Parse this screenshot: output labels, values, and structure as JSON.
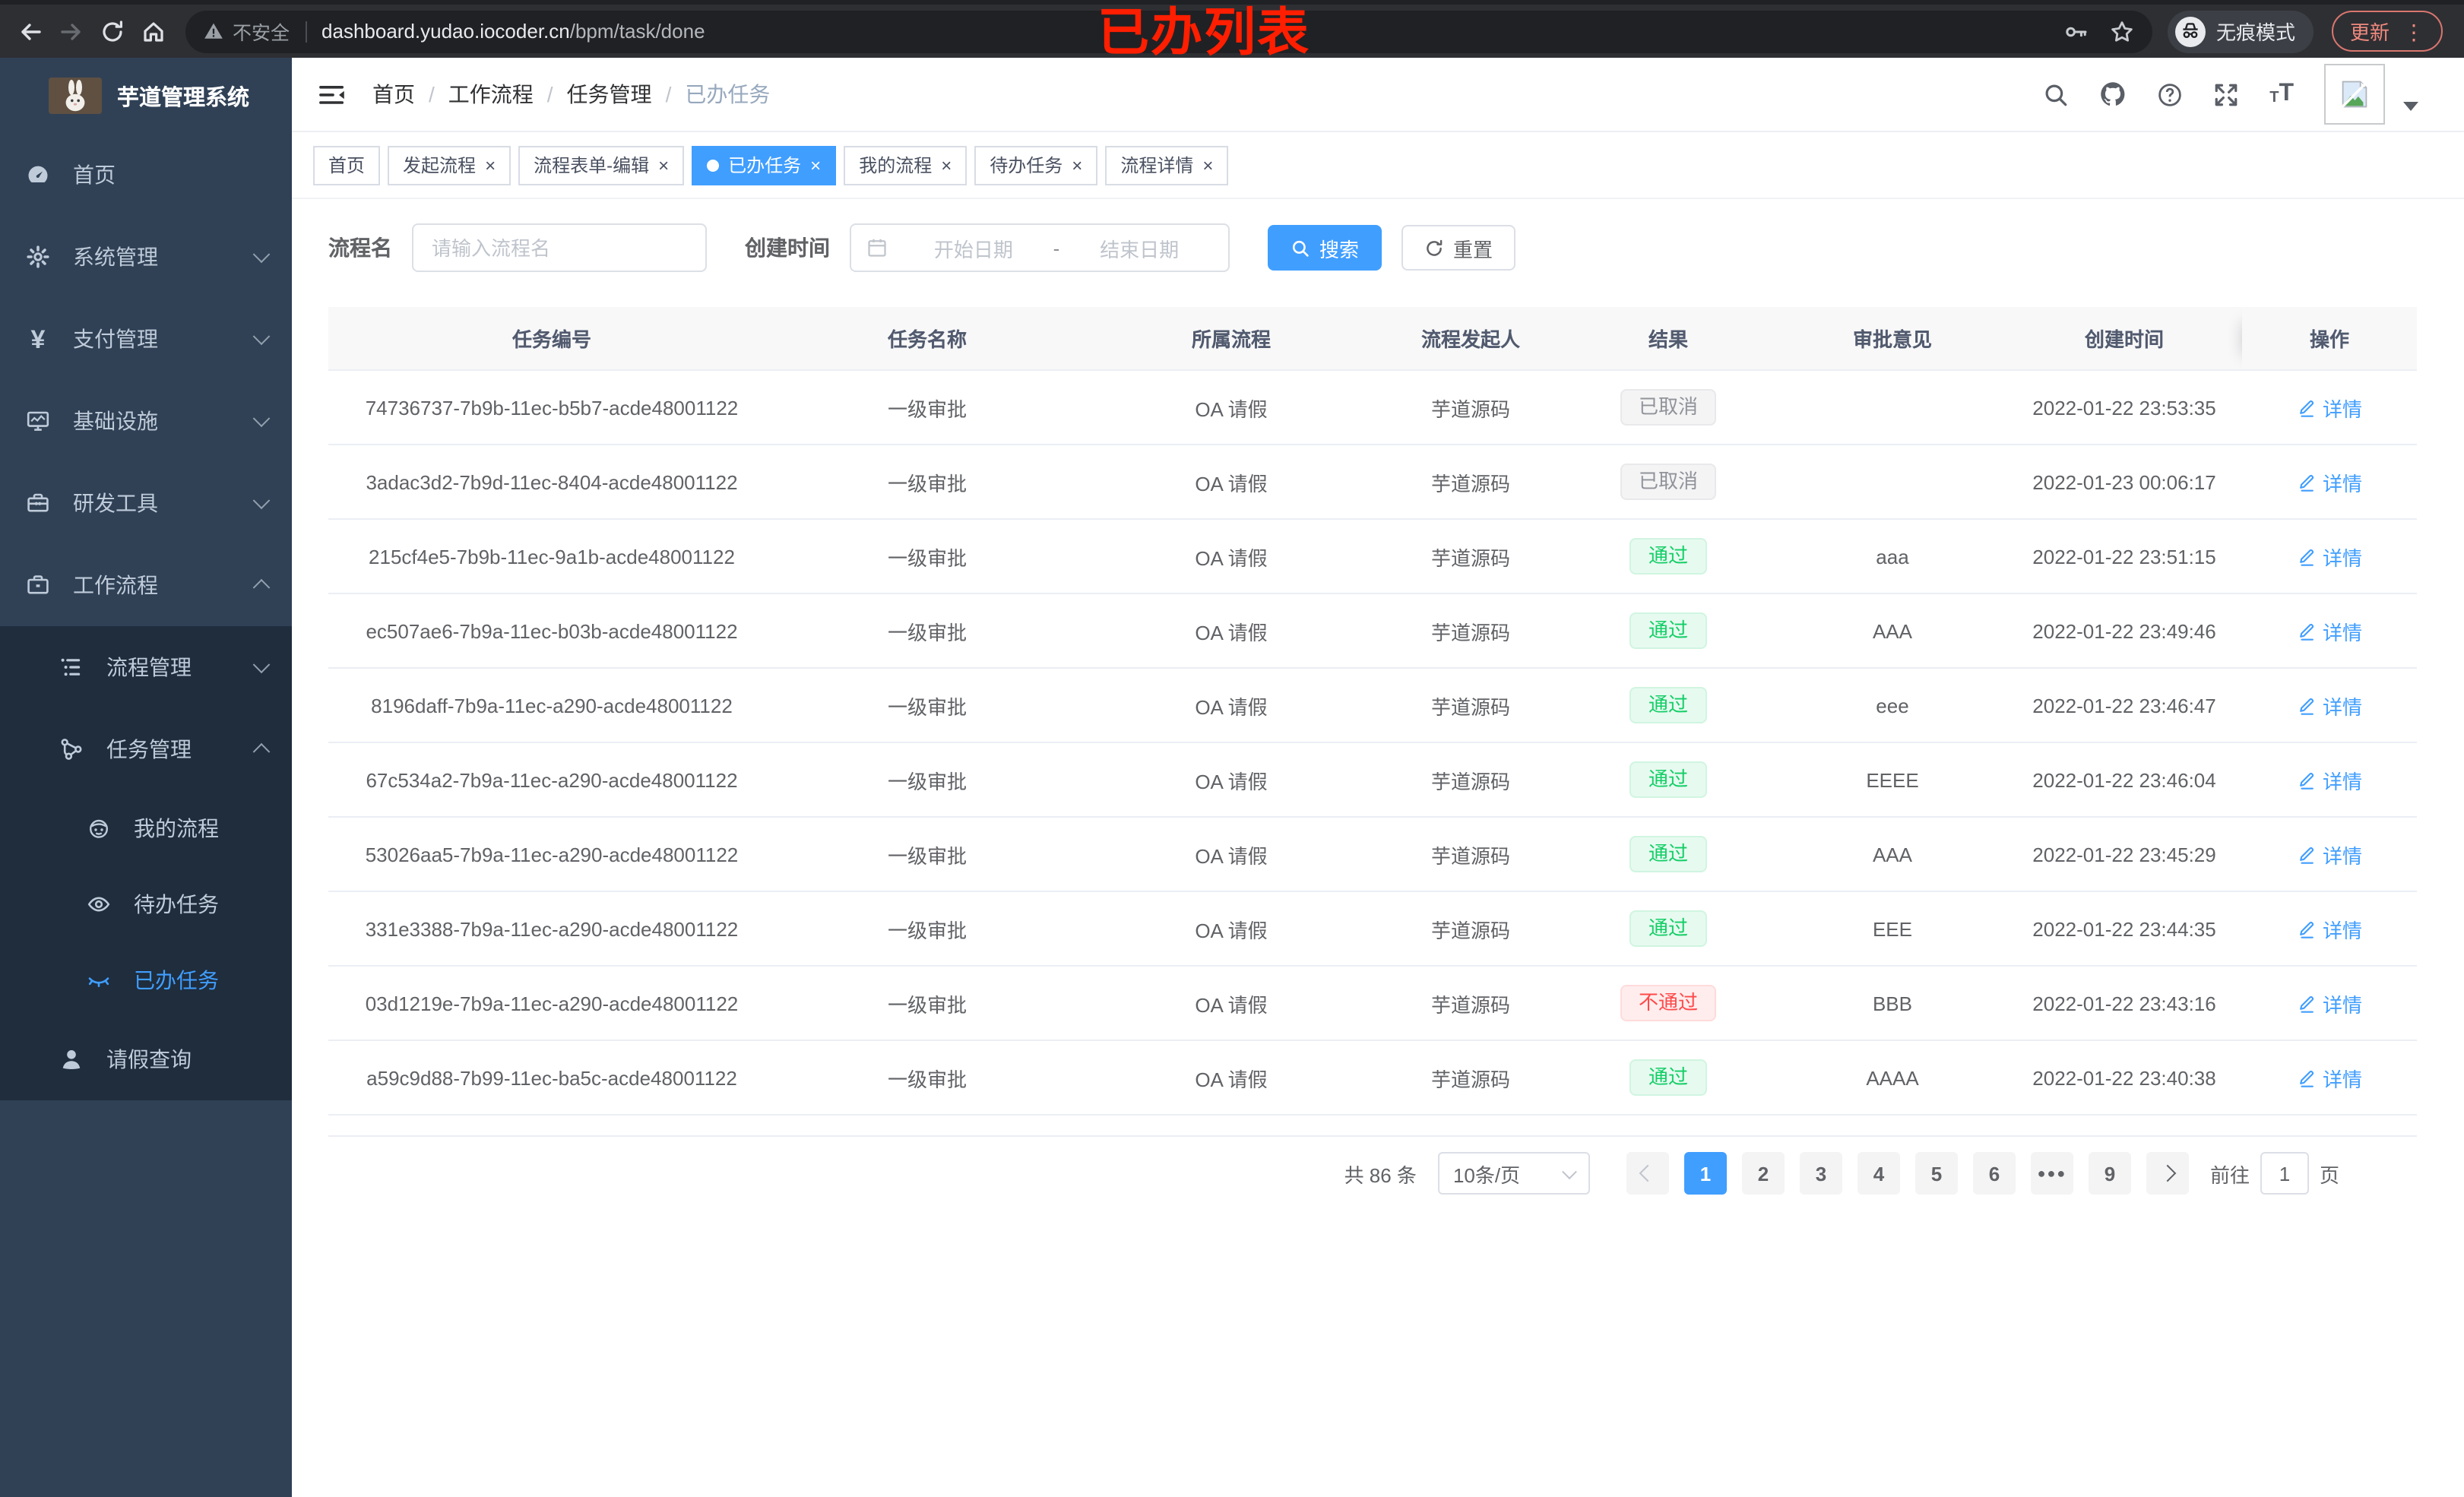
{
  "browser": {
    "security_label": "不安全",
    "url_domain": "dashboard.yudao.iocoder.cn",
    "url_path": "/bpm/task/done",
    "incognito_label": "无痕模式",
    "update_label": "更新"
  },
  "annotation": "已办列表",
  "sidebar": {
    "title": "芋道管理系统",
    "home": "首页",
    "system": "系统管理",
    "payment": "支付管理",
    "infra": "基础设施",
    "devtools": "研发工具",
    "workflow": "工作流程",
    "process_mgmt": "流程管理",
    "task_mgmt": "任务管理",
    "my_process": "我的流程",
    "todo_tasks": "待办任务",
    "done_tasks": "已办任务",
    "leave_query": "请假查询"
  },
  "breadcrumb": [
    "首页",
    "工作流程",
    "任务管理",
    "已办任务"
  ],
  "tabs": {
    "items": [
      {
        "label": "首页"
      },
      {
        "label": "发起流程"
      },
      {
        "label": "流程表单-编辑"
      },
      {
        "label": "已办任务"
      },
      {
        "label": "我的流程"
      },
      {
        "label": "待办任务"
      },
      {
        "label": "流程详情"
      }
    ]
  },
  "filters": {
    "name_label": "流程名",
    "name_placeholder": "请输入流程名",
    "time_label": "创建时间",
    "start_placeholder": "开始日期",
    "range_separator": "-",
    "end_placeholder": "结束日期",
    "search_label": "搜索",
    "reset_label": "重置"
  },
  "table": {
    "columns": [
      "任务编号",
      "任务名称",
      "所属流程",
      "流程发起人",
      "结果",
      "审批意见",
      "创建时间",
      "操作"
    ],
    "action_label": "详情",
    "rows": [
      {
        "id": "74736737-7b9b-11ec-b5b7-acde48001122",
        "name": "一级审批",
        "process": "OA 请假",
        "starter": "芋道源码",
        "result": "已取消",
        "state": "cancelled",
        "comment": "",
        "created": "2022-01-22 23:53:35"
      },
      {
        "id": "3adac3d2-7b9d-11ec-8404-acde48001122",
        "name": "一级审批",
        "process": "OA 请假",
        "starter": "芋道源码",
        "result": "已取消",
        "state": "cancelled",
        "comment": "",
        "created": "2022-01-23 00:06:17"
      },
      {
        "id": "215cf4e5-7b9b-11ec-9a1b-acde48001122",
        "name": "一级审批",
        "process": "OA 请假",
        "starter": "芋道源码",
        "result": "通过",
        "state": "passed",
        "comment": "aaa",
        "created": "2022-01-22 23:51:15"
      },
      {
        "id": "ec507ae6-7b9a-11ec-b03b-acde48001122",
        "name": "一级审批",
        "process": "OA 请假",
        "starter": "芋道源码",
        "result": "通过",
        "state": "passed",
        "comment": "AAA",
        "created": "2022-01-22 23:49:46"
      },
      {
        "id": "8196daff-7b9a-11ec-a290-acde48001122",
        "name": "一级审批",
        "process": "OA 请假",
        "starter": "芋道源码",
        "result": "通过",
        "state": "passed",
        "comment": "eee",
        "created": "2022-01-22 23:46:47"
      },
      {
        "id": "67c534a2-7b9a-11ec-a290-acde48001122",
        "name": "一级审批",
        "process": "OA 请假",
        "starter": "芋道源码",
        "result": "通过",
        "state": "passed",
        "comment": "EEEE",
        "created": "2022-01-22 23:46:04"
      },
      {
        "id": "53026aa5-7b9a-11ec-a290-acde48001122",
        "name": "一级审批",
        "process": "OA 请假",
        "starter": "芋道源码",
        "result": "通过",
        "state": "passed",
        "comment": "AAA",
        "created": "2022-01-22 23:45:29"
      },
      {
        "id": "331e3388-7b9a-11ec-a290-acde48001122",
        "name": "一级审批",
        "process": "OA 请假",
        "starter": "芋道源码",
        "result": "通过",
        "state": "passed",
        "comment": "EEE",
        "created": "2022-01-22 23:44:35"
      },
      {
        "id": "03d1219e-7b9a-11ec-a290-acde48001122",
        "name": "一级审批",
        "process": "OA 请假",
        "starter": "芋道源码",
        "result": "不通过",
        "state": "rejected",
        "comment": "BBB",
        "created": "2022-01-22 23:43:16"
      },
      {
        "id": "a59c9d88-7b99-11ec-ba5c-acde48001122",
        "name": "一级审批",
        "process": "OA 请假",
        "starter": "芋道源码",
        "result": "通过",
        "state": "passed",
        "comment": "AAAA",
        "created": "2022-01-22 23:40:38"
      }
    ]
  },
  "pagination": {
    "total": "共 86 条",
    "page_size": "10条/页",
    "pages": [
      {
        "n": "1",
        "cls": "active"
      },
      {
        "n": "2"
      },
      {
        "n": "3"
      },
      {
        "n": "4"
      },
      {
        "n": "5"
      },
      {
        "n": "6"
      },
      {
        "n": "●●●",
        "cls": "more"
      },
      {
        "n": "9"
      }
    ],
    "goto_label": "前往",
    "goto_value": "1",
    "unit_label": "页"
  },
  "icons": {
    "yen_glyph": "¥",
    "menu_dots_glyph": "⋮",
    "names": {
      "security": "warning-triangle",
      "incognito": "hat-and-glasses",
      "navbar": [
        "collapse-menu",
        "search",
        "github",
        "help",
        "fullscreen",
        "font-size",
        "avatar-broken-image",
        "caret-down"
      ],
      "sidebar": [
        "dashboard-gauge",
        "gear",
        "yen",
        "monitor",
        "toolbox",
        "briefcase",
        "list-tree",
        "share-nodes",
        "robot-face",
        "eye-open",
        "eye-closed",
        "user"
      ],
      "detail_action": "pencil"
    }
  }
}
